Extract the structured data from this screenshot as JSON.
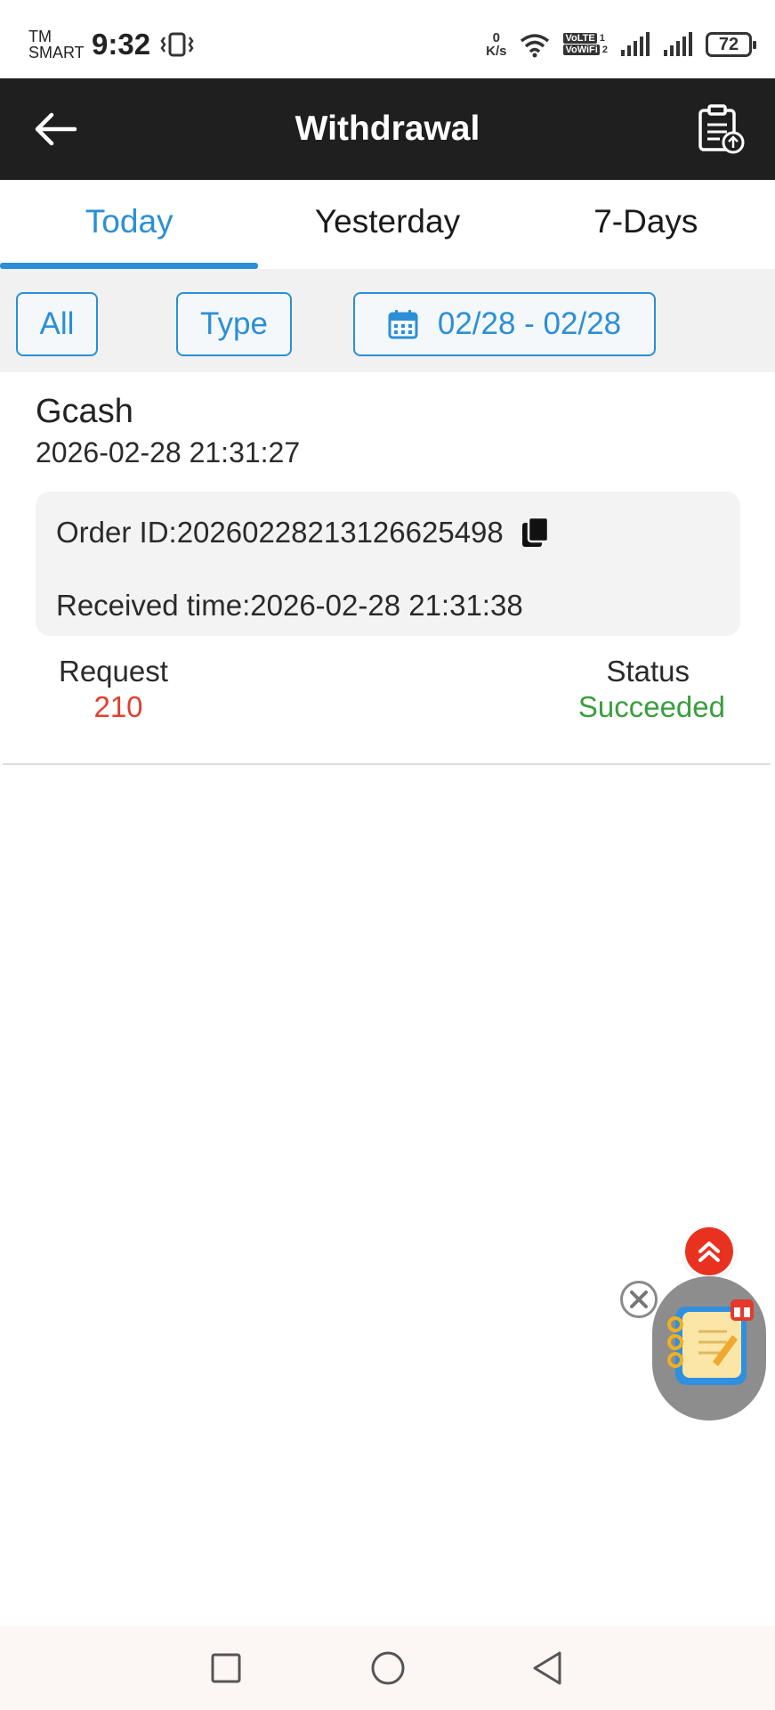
{
  "status_bar": {
    "carrier_line1": "TM",
    "carrier_line2": "SMART",
    "time": "9:32",
    "net_speed_value": "0",
    "net_speed_unit": "K/s",
    "volte_1": "VoLTE",
    "volte_1_sim": "1",
    "volte_2": "VoWiFi",
    "volte_2_sim": "2",
    "battery": "72"
  },
  "header": {
    "title": "Withdrawal",
    "back_icon": "arrow-left-icon",
    "action_icon": "clipboard-upload-icon"
  },
  "tabs": [
    {
      "label": "Today",
      "active": true
    },
    {
      "label": "Yesterday",
      "active": false
    },
    {
      "label": "7-Days",
      "active": false
    }
  ],
  "filters": {
    "all_label": "All",
    "type_label": "Type",
    "date_range": "02/28 - 02/28"
  },
  "record": {
    "method": "Gcash",
    "created_time": "2026-02-28 21:31:27",
    "order_id_text": "Order ID:20260228213126625498",
    "received_time_text": "Received time:2026-02-28 21:31:38",
    "request_label": "Request",
    "request_value": "210",
    "status_label": "Status",
    "status_value": "Succeeded"
  },
  "colors": {
    "accent": "#2b8fd6",
    "header_bg": "#1f1f1f",
    "request_value": "#e0402f",
    "status_success": "#3a9e3f"
  }
}
